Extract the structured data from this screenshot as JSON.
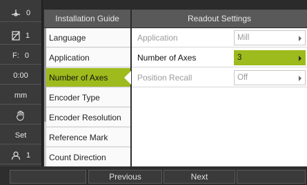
{
  "status_bar": {
    "items": [
      {
        "icon": "datum-icon",
        "value": "0"
      },
      {
        "icon": "tool-icon",
        "value": "1"
      },
      {
        "label": "F:",
        "value": "0"
      },
      {
        "value": "0:00"
      },
      {
        "value": "mm"
      },
      {
        "icon": "hand-icon"
      },
      {
        "value": "Set"
      },
      {
        "icon": "user-icon",
        "value": "1"
      }
    ]
  },
  "guide": {
    "title": "Installation Guide",
    "items": [
      {
        "label": "Language"
      },
      {
        "label": "Application"
      },
      {
        "label": "Number of Axes"
      },
      {
        "label": "Encoder Type"
      },
      {
        "label": "Encoder Resolution"
      },
      {
        "label": "Reference Mark"
      },
      {
        "label": "Count Direction"
      }
    ],
    "selected": "Number of Axes"
  },
  "settings": {
    "title": "Readout Settings",
    "rows": [
      {
        "label": "Application",
        "value": "Mill"
      },
      {
        "label": "Number of Axes",
        "value": "3"
      },
      {
        "label": "Position Recall",
        "value": "Off"
      }
    ]
  },
  "softkeys": {
    "items": [
      {
        "label": ""
      },
      {
        "label": "Previous"
      },
      {
        "label": "Next"
      },
      {
        "label": ""
      }
    ]
  },
  "colors": {
    "accent": "#9dbb1c",
    "header": "#595959",
    "background": "#2b2b2b"
  }
}
